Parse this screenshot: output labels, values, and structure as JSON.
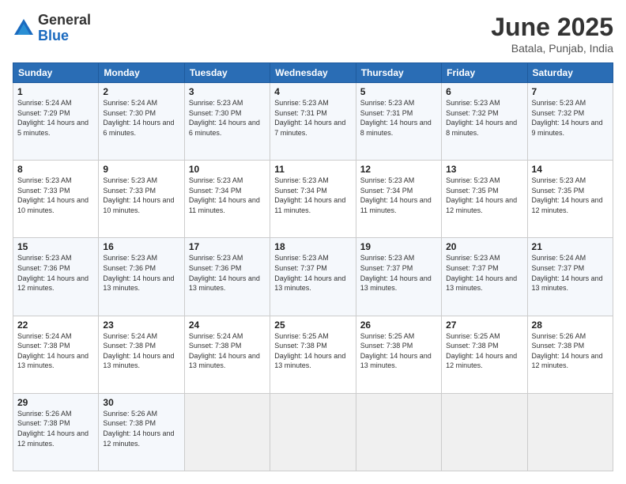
{
  "header": {
    "logo_general": "General",
    "logo_blue": "Blue",
    "month_title": "June 2025",
    "location": "Batala, Punjab, India"
  },
  "weekdays": [
    "Sunday",
    "Monday",
    "Tuesday",
    "Wednesday",
    "Thursday",
    "Friday",
    "Saturday"
  ],
  "weeks": [
    [
      {
        "day": 1,
        "sunrise": "5:24 AM",
        "sunset": "7:29 PM",
        "daylight": "14 hours and 5 minutes."
      },
      {
        "day": 2,
        "sunrise": "5:24 AM",
        "sunset": "7:30 PM",
        "daylight": "14 hours and 6 minutes."
      },
      {
        "day": 3,
        "sunrise": "5:23 AM",
        "sunset": "7:30 PM",
        "daylight": "14 hours and 6 minutes."
      },
      {
        "day": 4,
        "sunrise": "5:23 AM",
        "sunset": "7:31 PM",
        "daylight": "14 hours and 7 minutes."
      },
      {
        "day": 5,
        "sunrise": "5:23 AM",
        "sunset": "7:31 PM",
        "daylight": "14 hours and 8 minutes."
      },
      {
        "day": 6,
        "sunrise": "5:23 AM",
        "sunset": "7:32 PM",
        "daylight": "14 hours and 8 minutes."
      },
      {
        "day": 7,
        "sunrise": "5:23 AM",
        "sunset": "7:32 PM",
        "daylight": "14 hours and 9 minutes."
      }
    ],
    [
      {
        "day": 8,
        "sunrise": "5:23 AM",
        "sunset": "7:33 PM",
        "daylight": "14 hours and 10 minutes."
      },
      {
        "day": 9,
        "sunrise": "5:23 AM",
        "sunset": "7:33 PM",
        "daylight": "14 hours and 10 minutes."
      },
      {
        "day": 10,
        "sunrise": "5:23 AM",
        "sunset": "7:34 PM",
        "daylight": "14 hours and 11 minutes."
      },
      {
        "day": 11,
        "sunrise": "5:23 AM",
        "sunset": "7:34 PM",
        "daylight": "14 hours and 11 minutes."
      },
      {
        "day": 12,
        "sunrise": "5:23 AM",
        "sunset": "7:34 PM",
        "daylight": "14 hours and 11 minutes."
      },
      {
        "day": 13,
        "sunrise": "5:23 AM",
        "sunset": "7:35 PM",
        "daylight": "14 hours and 12 minutes."
      },
      {
        "day": 14,
        "sunrise": "5:23 AM",
        "sunset": "7:35 PM",
        "daylight": "14 hours and 12 minutes."
      }
    ],
    [
      {
        "day": 15,
        "sunrise": "5:23 AM",
        "sunset": "7:36 PM",
        "daylight": "14 hours and 12 minutes."
      },
      {
        "day": 16,
        "sunrise": "5:23 AM",
        "sunset": "7:36 PM",
        "daylight": "14 hours and 13 minutes."
      },
      {
        "day": 17,
        "sunrise": "5:23 AM",
        "sunset": "7:36 PM",
        "daylight": "14 hours and 13 minutes."
      },
      {
        "day": 18,
        "sunrise": "5:23 AM",
        "sunset": "7:37 PM",
        "daylight": "14 hours and 13 minutes."
      },
      {
        "day": 19,
        "sunrise": "5:23 AM",
        "sunset": "7:37 PM",
        "daylight": "14 hours and 13 minutes."
      },
      {
        "day": 20,
        "sunrise": "5:23 AM",
        "sunset": "7:37 PM",
        "daylight": "14 hours and 13 minutes."
      },
      {
        "day": 21,
        "sunrise": "5:24 AM",
        "sunset": "7:37 PM",
        "daylight": "14 hours and 13 minutes."
      }
    ],
    [
      {
        "day": 22,
        "sunrise": "5:24 AM",
        "sunset": "7:38 PM",
        "daylight": "14 hours and 13 minutes."
      },
      {
        "day": 23,
        "sunrise": "5:24 AM",
        "sunset": "7:38 PM",
        "daylight": "14 hours and 13 minutes."
      },
      {
        "day": 24,
        "sunrise": "5:24 AM",
        "sunset": "7:38 PM",
        "daylight": "14 hours and 13 minutes."
      },
      {
        "day": 25,
        "sunrise": "5:25 AM",
        "sunset": "7:38 PM",
        "daylight": "14 hours and 13 minutes."
      },
      {
        "day": 26,
        "sunrise": "5:25 AM",
        "sunset": "7:38 PM",
        "daylight": "14 hours and 13 minutes."
      },
      {
        "day": 27,
        "sunrise": "5:25 AM",
        "sunset": "7:38 PM",
        "daylight": "14 hours and 12 minutes."
      },
      {
        "day": 28,
        "sunrise": "5:26 AM",
        "sunset": "7:38 PM",
        "daylight": "14 hours and 12 minutes."
      }
    ],
    [
      {
        "day": 29,
        "sunrise": "5:26 AM",
        "sunset": "7:38 PM",
        "daylight": "14 hours and 12 minutes."
      },
      {
        "day": 30,
        "sunrise": "5:26 AM",
        "sunset": "7:38 PM",
        "daylight": "14 hours and 12 minutes."
      },
      null,
      null,
      null,
      null,
      null
    ]
  ]
}
